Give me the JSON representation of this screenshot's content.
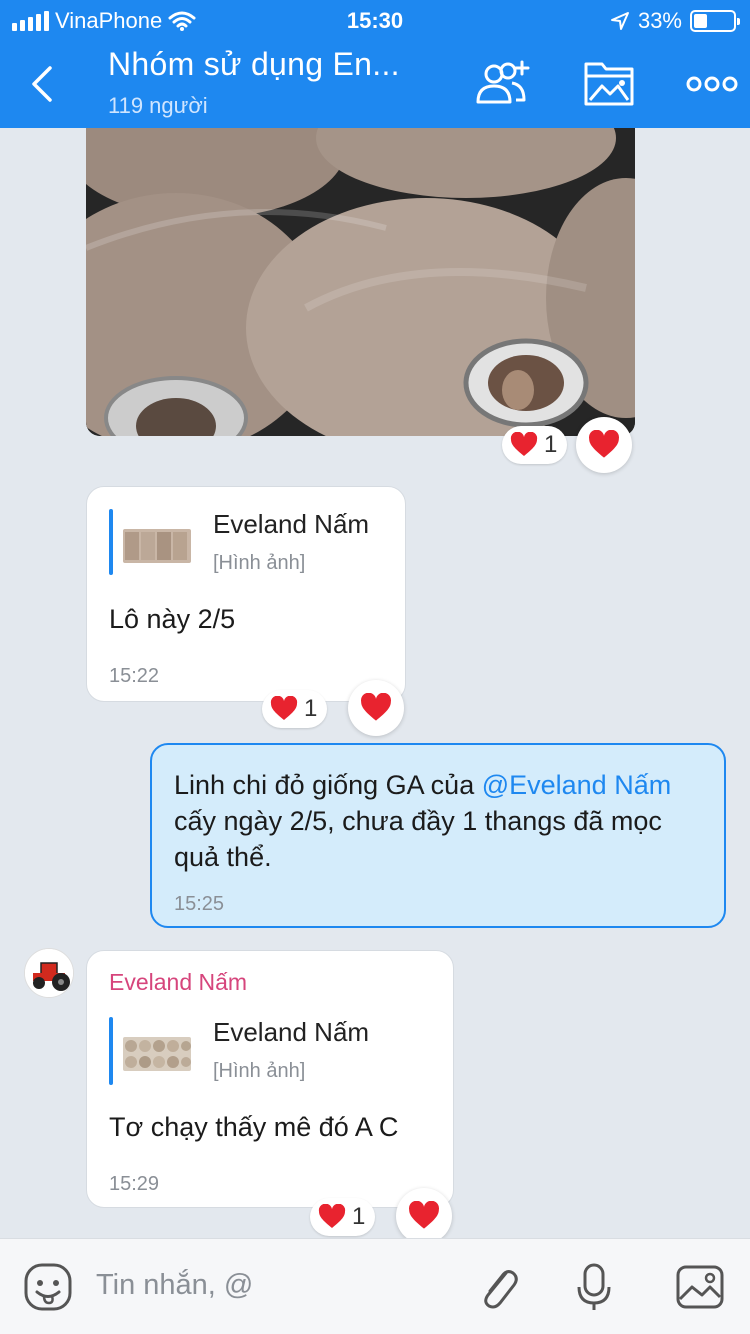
{
  "status": {
    "carrier": "VinaPhone",
    "time": "15:30",
    "battery": "33%",
    "battery_level": 0.33
  },
  "header": {
    "title": "Nhóm sử dụng En...",
    "subtitle": "119 người"
  },
  "icons": {
    "back": "chevron-left-icon",
    "add_member": "add-user-icon",
    "media": "gallery-icon",
    "more": "more-icon",
    "emoji": "emoji-icon",
    "attach": "paperclip-icon",
    "mic": "microphone-icon",
    "image": "image-icon"
  },
  "colors": {
    "brand": "#1e88f0",
    "sender": "#d6457c",
    "heart": "#e8232f",
    "my_bubble": "#d4ecfb"
  },
  "messages": [
    {
      "type": "photo",
      "reaction_count": "1"
    },
    {
      "type": "reply",
      "quote_name": "Eveland Nấm",
      "quote_sub": "[Hình ảnh]",
      "text": "Lô này 2/5",
      "time": "15:22",
      "reaction_count": "1"
    },
    {
      "type": "mine",
      "text_before": "Linh chi đỏ giống GA của ",
      "mention": "@Eveland Nấm",
      "text_after": "  cấy ngày 2/5, chưa đầy 1 thangs đã mọc quả thể.",
      "time": "15:25"
    },
    {
      "type": "reply",
      "sender": "Eveland Nấm",
      "quote_name": "Eveland Nấm",
      "quote_sub": "[Hình ảnh]",
      "text": "Tơ chạy thấy mê đó A C",
      "time": "15:29",
      "reaction_count": "1"
    }
  ],
  "input": {
    "placeholder": "Tin nhắn, @"
  }
}
